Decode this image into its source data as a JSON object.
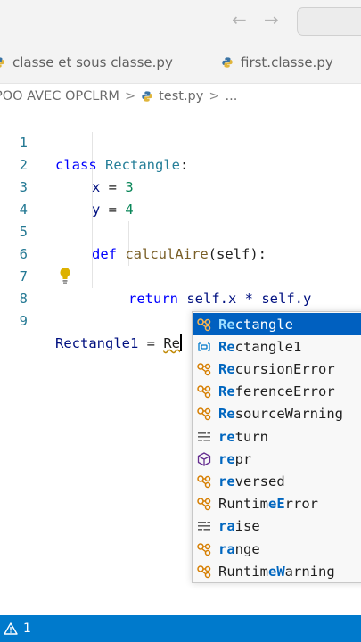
{
  "titlebar": {
    "back_icon": "arrow-left-icon",
    "forward_icon": "arrow-right-icon"
  },
  "tabs": [
    {
      "label": "classe et sous classe.py",
      "icon": "python-file-icon"
    },
    {
      "label": "first.classe.py",
      "icon": "python-file-icon"
    }
  ],
  "breadcrumb": {
    "folder": "POO AVEC OPCLRM",
    "file": "test.py",
    "more": "..."
  },
  "editor": {
    "line_numbers": [
      "1",
      "2",
      "3",
      "4",
      "5",
      "6",
      "7",
      "8",
      "9"
    ],
    "code": {
      "l1_kw": "class",
      "l1_cls": "Rectangle",
      "l1_rest": ":",
      "l2_var": "x",
      "l2_op": " = ",
      "l2_num": "3",
      "l3_var": "y",
      "l3_op": " = ",
      "l3_num": "4",
      "l5_kw": "def",
      "l5_fn": "calculAire",
      "l5_rest": "(self):",
      "l7_kw": "return",
      "l7_rest": " self.x * self.y",
      "l9_var": "Rectangle1",
      "l9_op": " = ",
      "l9_typed": "Re"
    }
  },
  "suggestions": [
    {
      "match": "Re",
      "rest": "ctangle",
      "icon": "class-icon",
      "selected": true
    },
    {
      "match": "Re",
      "rest": "ctangle1",
      "icon": "variable-icon"
    },
    {
      "match": "Re",
      "rest": "cursionError",
      "icon": "class-icon"
    },
    {
      "match": "Re",
      "rest": "ferenceError",
      "icon": "class-icon"
    },
    {
      "match": "Re",
      "rest": "sourceWarning",
      "icon": "class-icon"
    },
    {
      "match": "re",
      "rest": "turn",
      "icon": "keyword-icon"
    },
    {
      "match": "re",
      "rest": "pr",
      "icon": "method-icon"
    },
    {
      "match": "re",
      "rest": "versed",
      "icon": "class-icon"
    },
    {
      "pre": "Runtim",
      "match": "eE",
      "rest": "rror",
      "icon": "class-icon"
    },
    {
      "match": "ra",
      "rest": "ise",
      "icon": "keyword-icon"
    },
    {
      "match": "ra",
      "rest": "nge",
      "icon": "class-icon"
    },
    {
      "pre": "Runtim",
      "match": "eW",
      "rest": "arning",
      "icon": "class-icon"
    }
  ],
  "statusbar": {
    "warning_icon": "warning-icon",
    "warning_count": "1"
  },
  "colors": {
    "accent": "#007acc",
    "selection": "#0060c0",
    "match": "#0066bf"
  }
}
